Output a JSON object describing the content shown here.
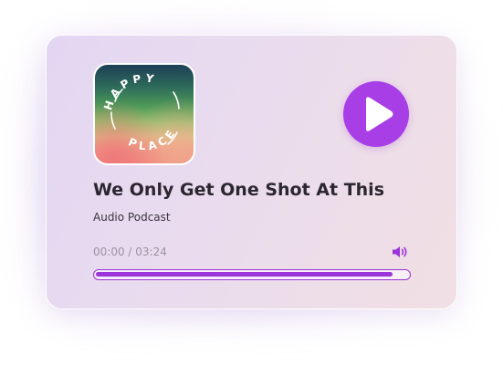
{
  "player": {
    "title": "We Only Get One Shot At This",
    "subtitle": "Audio Podcast",
    "current_time": "00:00",
    "separator": " / ",
    "duration": "03:24",
    "progress_fraction": 0.95,
    "accent_color": "#a83ee6"
  },
  "cover": {
    "logo_text_top": "HAPPY",
    "logo_text_bottom": "PLACE"
  },
  "icons": {
    "play": "play-icon",
    "volume": "volume-icon"
  }
}
